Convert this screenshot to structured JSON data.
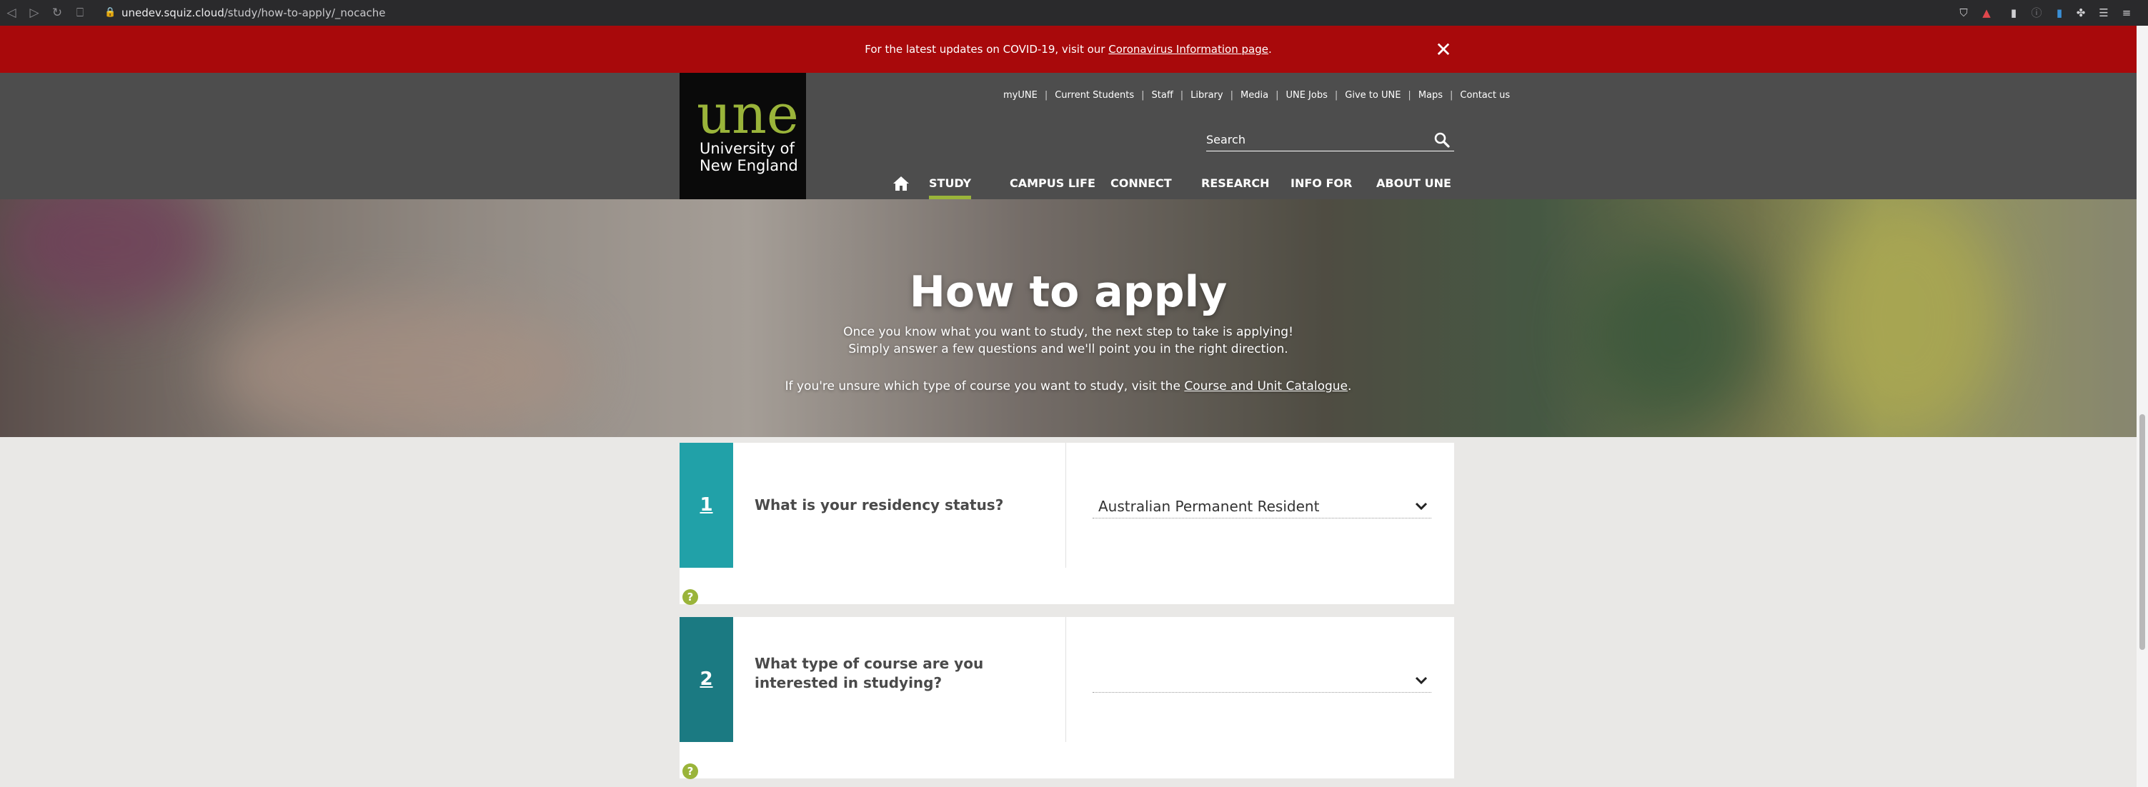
{
  "browser": {
    "url_host": "unedev.squiz.cloud",
    "url_path": "/study/how-to-apply/_nocache"
  },
  "alert": {
    "text": "For the latest updates on COVID-19, visit our ",
    "link": "Coronavirus Information page",
    "suffix": "."
  },
  "logo": {
    "mark": "une",
    "name_line1": "University of",
    "name_line2": "New England"
  },
  "utility_nav": [
    "myUNE",
    "Current Students",
    "Staff",
    "Library",
    "Media",
    "UNE Jobs",
    "Give to UNE",
    "Maps",
    "Contact us"
  ],
  "search": {
    "placeholder": "Search"
  },
  "main_nav": {
    "home_icon": "home-icon",
    "items": [
      "STUDY",
      "CAMPUS LIFE",
      "CONNECT",
      "RESEARCH",
      "INFO FOR",
      "ABOUT UNE"
    ],
    "active": "STUDY"
  },
  "hero": {
    "title": "How to apply",
    "line1": "Once you know what you want to study, the next step to take is applying!",
    "line2": "Simply answer a few questions and we'll point you in the right direction.",
    "line3_prefix": "If you're unsure which type of course you want to study, visit the ",
    "line3_link": "Course and Unit Catalogue",
    "line3_suffix": "."
  },
  "questions": [
    {
      "number": "1",
      "label": "What is your residency status?",
      "selected": "Australian Permanent Resident",
      "color": "#21a1a8"
    },
    {
      "number": "2",
      "label": "What type of course are you interested in studying?",
      "selected": "",
      "color": "#1b7a82"
    }
  ],
  "help_icon": "?",
  "colors": {
    "alert": "#a8090b",
    "header": "#4d4d4d",
    "accent": "#9ab43a"
  }
}
